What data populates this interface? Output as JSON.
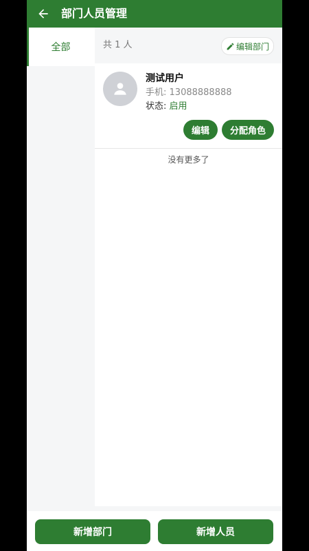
{
  "header": {
    "title": "部门人员管理",
    "back_icon": "arrow-left-icon"
  },
  "sidebar": {
    "items": [
      {
        "label": "全部",
        "active": true
      }
    ]
  },
  "summary": {
    "count_text": "共 1 人",
    "edit_department_label": "编辑部门",
    "edit_icon": "pencil-icon"
  },
  "users": [
    {
      "name": "测试用户",
      "phone_label": "手机:",
      "phone": "13088888888",
      "status_label": "状态:",
      "status": "启用",
      "edit_label": "编辑",
      "assign_role_label": "分配角色"
    }
  ],
  "list_end_text": "没有更多了",
  "footer": {
    "add_department_label": "新增部门",
    "add_member_label": "新增人员"
  },
  "colors": {
    "brand": "#2e7d32",
    "avatar_bg": "#cfd1d6",
    "status_enabled": "#2e7d32"
  }
}
